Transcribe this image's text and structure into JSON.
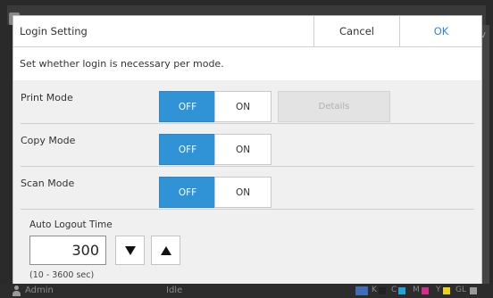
{
  "dialog": {
    "title": "Login Setting",
    "cancel_label": "Cancel",
    "ok_label": "OK",
    "description": "Set whether login is necessary per mode."
  },
  "modes": [
    {
      "label": "Print Mode",
      "off_label": "OFF",
      "on_label": "ON",
      "selected": "OFF",
      "details_label": "Details"
    },
    {
      "label": "Copy Mode",
      "off_label": "OFF",
      "on_label": "ON",
      "selected": "OFF"
    },
    {
      "label": "Scan Mode",
      "off_label": "OFF",
      "on_label": "ON",
      "selected": "OFF"
    }
  ],
  "auto_logout": {
    "label": "Auto Logout Time",
    "value": "300",
    "range": "(10 - 3600 sec)"
  },
  "status_bar": {
    "user": "Admin",
    "state": "Idle",
    "inks": [
      {
        "label": "K",
        "color": "#222222"
      },
      {
        "label": "C",
        "color": "#1fa3d8"
      },
      {
        "label": "M",
        "color": "#d0308a"
      },
      {
        "label": "Y",
        "color": "#e8d21c"
      },
      {
        "label": "GL",
        "color": "#9a9a9a"
      }
    ]
  },
  "colors": {
    "accent": "#2f93d6",
    "ok_text": "#2f86c8"
  }
}
